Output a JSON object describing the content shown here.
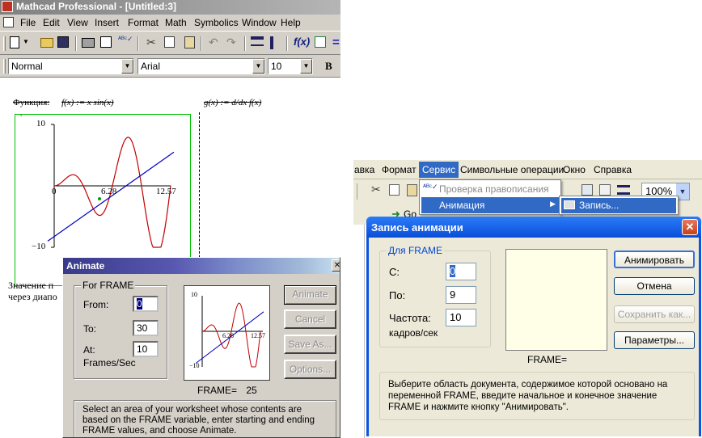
{
  "left": {
    "title": "Mathcad Professional - [Untitled:3]",
    "menu": [
      "File",
      "Edit",
      "View",
      "Insert",
      "Format",
      "Math",
      "Symbolics",
      "Window",
      "Help"
    ],
    "format": {
      "style": "Normal",
      "font": "Arial",
      "size": "10",
      "bold": "B"
    },
    "worksheet": {
      "fn_label": "Функция:",
      "fn_expr": "f(x) := x·sin(x)",
      "deriv_expr": "g(x) := d/dx f(x)",
      "deriv_d": "d",
      "text1": "Значение п",
      "text2": "через диапо"
    },
    "plot": {
      "y_max": "10",
      "y_min": "−10",
      "x_zero": "0",
      "x_mid": "6.28",
      "x_max": "12.57"
    },
    "animate": {
      "title": "Animate",
      "group": "For FRAME",
      "from_label": "From:",
      "from_value": "0",
      "to_label": "To:",
      "to_value": "30",
      "at_label": "At:",
      "at_value": "10",
      "fps_label": "Frames/Sec",
      "btn_animate": "Animate",
      "btn_cancel": "Cancel",
      "btn_save": "Save As...",
      "btn_options": "Options...",
      "frame_label": "FRAME=",
      "frame_value": "25",
      "preview": {
        "y_max": "10",
        "y_min": "−10",
        "x_mid": "6.28",
        "x_max": "12.57"
      },
      "hint": "Select an area of your worksheet whose contents are based on the FRAME variable, enter starting and ending FRAME values, and choose Animate."
    }
  },
  "right": {
    "menu": [
      "авка",
      "Формат",
      "Сервис",
      "Символьные операции",
      "Окно",
      "Справка"
    ],
    "spell": "Проверка правописания",
    "animation": "Анимация",
    "record": "Запись...",
    "zoom": "100%",
    "go": "Go",
    "dialog": {
      "title": "Запись анимации",
      "group": "Для FRAME",
      "from_label": "С:",
      "from_value": "0",
      "to_label": "По:",
      "to_value": "9",
      "rate_label": "Частота:",
      "rate_value": "10",
      "rate_unit": "кадров/сек",
      "frame_label": "FRAME=",
      "btn_animate": "Анимировать",
      "btn_cancel": "Отмена",
      "btn_save": "Сохранить как...",
      "btn_params": "Параметры...",
      "hint": "Выберите область документа, содержимое которой основано на переменной FRAME, введите начальное и конечное значение FRAME и нажмите кнопку \"Анимировать\"."
    }
  }
}
